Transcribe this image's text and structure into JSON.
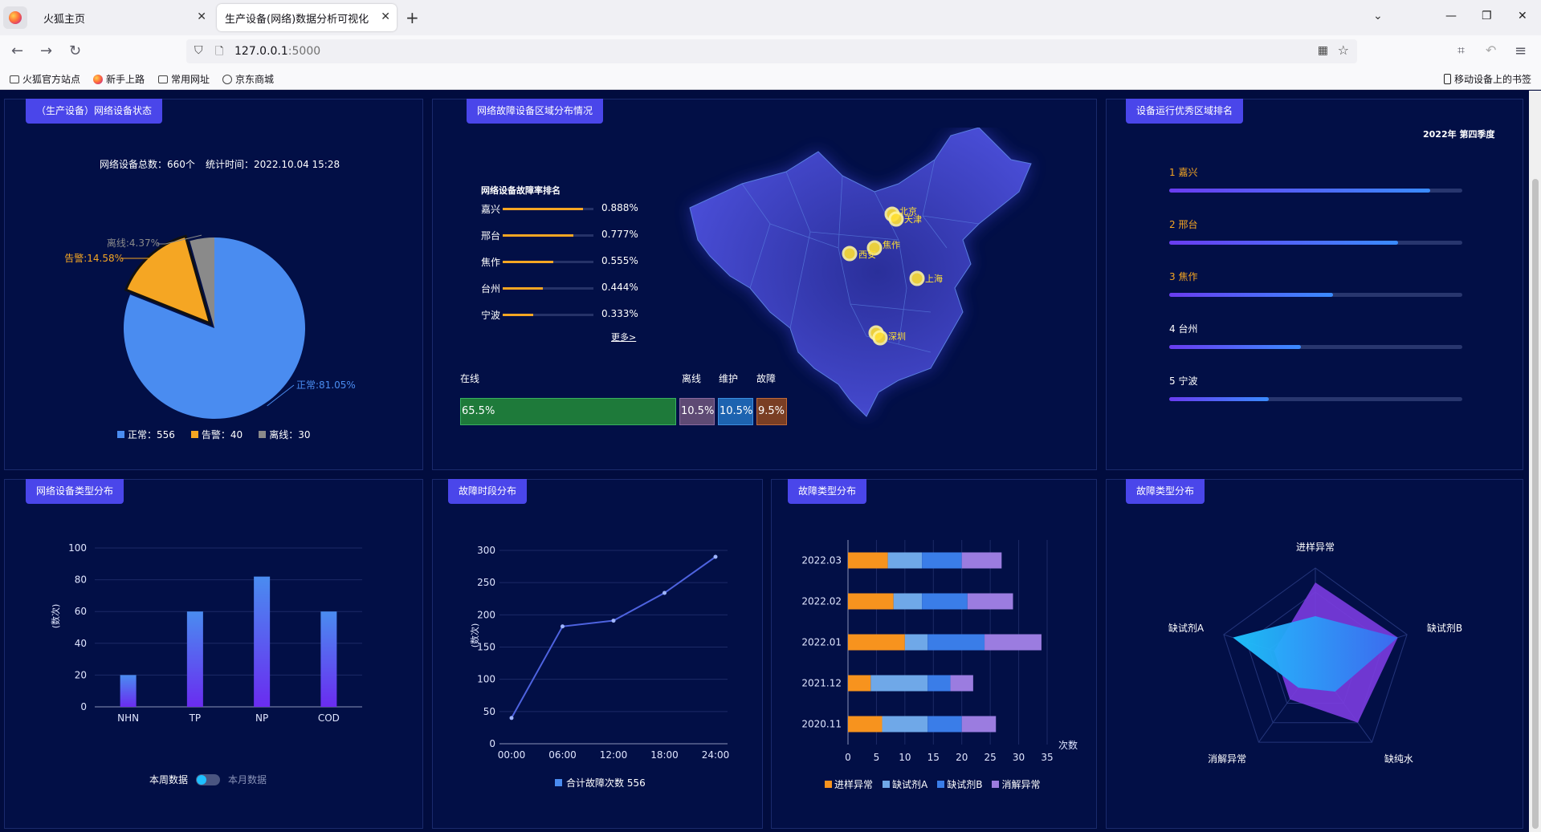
{
  "browser": {
    "tabs": [
      {
        "label": "火狐主页"
      },
      {
        "label": "生产设备(网络)数据分析可视化系统"
      }
    ],
    "url_host": "127.0.0.1",
    "url_port": ":5000",
    "bookmarks": [
      "火狐官方站点",
      "新手上路",
      "常用网址",
      "京东商城"
    ],
    "mobile_bookmarks": "移动设备上的书签"
  },
  "panel1": {
    "title": "（生产设备）网络设备状态",
    "total": "网络设备总数：660个",
    "time": "统计时间：2022.10.04 15:28",
    "slices": [
      {
        "label": "正常:81.05%",
        "value": 81.05,
        "color": "#4a8cf0"
      },
      {
        "label": "告警:14.58%",
        "value": 14.58,
        "color": "#f5a623"
      },
      {
        "label": "离线:4.37%",
        "value": 4.37,
        "color": "#8a8a8a"
      }
    ],
    "legend": [
      {
        "label": "正常：556",
        "color": "#4a8cf0"
      },
      {
        "label": "告警：40",
        "color": "#f5a623"
      },
      {
        "label": "离线：30",
        "color": "#8a8a8a"
      }
    ]
  },
  "panel2": {
    "title": "网络故障设备区域分布情况",
    "rank_title": "网络设备故障率排名",
    "rank": [
      {
        "city": "嘉兴",
        "value": "0.888%",
        "fill": 0.888
      },
      {
        "city": "邢台",
        "value": "0.777%",
        "fill": 0.777
      },
      {
        "city": "焦作",
        "value": "0.555%",
        "fill": 0.555
      },
      {
        "city": "台州",
        "value": "0.444%",
        "fill": 0.444
      },
      {
        "city": "宁波",
        "value": "0.333%",
        "fill": 0.333
      }
    ],
    "more": "更多>",
    "status_labels": [
      "在线",
      "离线",
      "维护",
      "故障"
    ],
    "status_values": [
      "65.5%",
      "10.5%",
      "10.5%",
      "9.5%"
    ],
    "map_cities": [
      "北京",
      "天津",
      "焦作",
      "西安",
      "上海",
      "深圳"
    ]
  },
  "panel3": {
    "title": "设备运行优秀区域排名",
    "quarter": "2022年 第四季度",
    "items": [
      {
        "label": "1  嘉兴",
        "fill": 0.89,
        "color": "#f5a623"
      },
      {
        "label": "2  邢台",
        "fill": 0.78,
        "color": "#f5a623"
      },
      {
        "label": "3  焦作",
        "fill": 0.56,
        "color": "#f5a623"
      },
      {
        "label": "4  台州",
        "fill": 0.45,
        "color": "#ffffff"
      },
      {
        "label": "5  宁波",
        "fill": 0.34,
        "color": "#ffffff"
      }
    ]
  },
  "panel4": {
    "title": "网络设备类型分布",
    "toggle_left": "本周数据",
    "toggle_right": "本月数据",
    "chart_data": {
      "type": "bar",
      "categories": [
        "NHN",
        "TP",
        "NP",
        "COD"
      ],
      "values": [
        20,
        60,
        82,
        60
      ],
      "ylabel": "(数次)",
      "ylim": [
        0,
        100
      ],
      "yticks": [
        0,
        20,
        40,
        60,
        80,
        100
      ]
    }
  },
  "panel5": {
    "title": "故障时段分布",
    "chart_data": {
      "type": "line",
      "x": [
        0,
        4,
        8,
        12,
        16,
        20,
        24
      ],
      "xticks": [
        "00:00",
        "06:00",
        "12:00",
        "18:00",
        "24:00"
      ],
      "values": [
        40,
        182,
        191,
        234,
        290
      ],
      "ylabel": "(数次)",
      "ylim": [
        0,
        300
      ],
      "yticks": [
        0,
        50,
        100,
        150,
        200,
        250,
        300
      ],
      "legend": "合计故障次数 556"
    }
  },
  "panel6": {
    "title": "故障类型分布",
    "chart_data": {
      "type": "bar",
      "orientation": "horizontal-stacked",
      "categories": [
        "2022.03",
        "2022.02",
        "2022.01",
        "2021.12",
        "2020.11"
      ],
      "series": [
        {
          "name": "进样异常",
          "color": "#f7931e",
          "values": [
            7,
            8,
            10,
            4,
            6
          ]
        },
        {
          "name": "缺试剂A",
          "color": "#6fa8e8",
          "values": [
            6,
            5,
            4,
            10,
            8
          ]
        },
        {
          "name": "缺试剂B",
          "color": "#3a7de8",
          "values": [
            7,
            8,
            10,
            4,
            6
          ]
        },
        {
          "name": "消解异常",
          "color": "#9b7ce0",
          "values": [
            7,
            8,
            10,
            4,
            6
          ]
        }
      ],
      "xlabel": "次数",
      "xlim": [
        0,
        35
      ],
      "xticks": [
        0,
        5,
        10,
        15,
        20,
        25,
        30,
        35
      ]
    }
  },
  "panel7": {
    "title": "故障类型分布",
    "chart_data": {
      "type": "radar",
      "axes": [
        "进样异常",
        "缺试剂B",
        "缺纯水",
        "消解异常",
        "缺试剂A"
      ],
      "series": [
        {
          "values": [
            0.85,
            0.9,
            0.75,
            0.45,
            0.45
          ],
          "color": "#7b3ce0"
        },
        {
          "values": [
            0.5,
            0.9,
            0.35,
            0.3,
            0.9
          ],
          "color": "#2fb8ff"
        }
      ]
    }
  }
}
